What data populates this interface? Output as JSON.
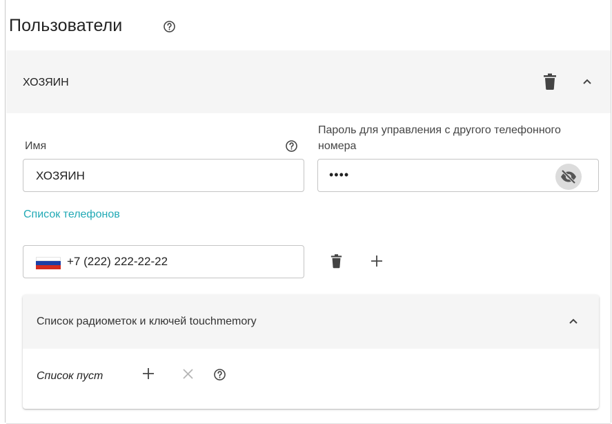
{
  "page": {
    "title": "Пользователи",
    "title_help_icon": "help-circle-icon"
  },
  "user": {
    "header_title": "ХОЗЯИН",
    "delete_icon": "trash-icon",
    "collapse_icon": "chevron-up-icon",
    "name_label": "Имя",
    "name_value": "ХОЗЯИН",
    "password_label": "Пароль для управления с другого телефонного номера",
    "password_value": "••••",
    "password_toggle_icon": "eye-off-icon"
  },
  "phones": {
    "section_label": "Список телефонов",
    "items": [
      {
        "country": "RU",
        "flag_colors": [
          "#ffffff",
          "#1c3fa6",
          "#d52b1e"
        ],
        "number": "+7 (222) 222-22-22"
      }
    ],
    "delete_icon": "trash-icon",
    "add_icon": "plus-icon"
  },
  "radio_tags": {
    "title": "Список радиометок и ключей touchmemory",
    "collapse_icon": "chevron-up-icon",
    "empty_text": "Список пуст",
    "add_icon": "plus-icon",
    "clear_icon": "close-icon",
    "help_icon": "help-circle-icon"
  },
  "colors": {
    "accent": "#21a9b5",
    "header_bg": "#f5f5f5",
    "border": "#c4c4c4"
  }
}
